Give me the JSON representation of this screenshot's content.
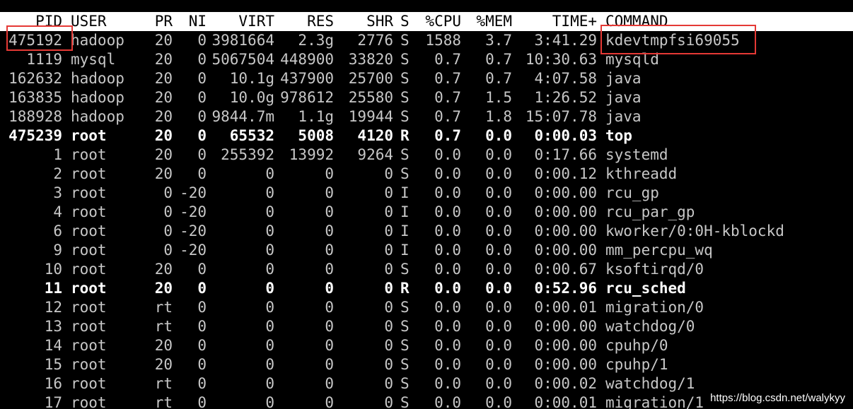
{
  "colors": {
    "background": "#000000",
    "text": "#c7c7c7",
    "text_running": "#ffffff",
    "header_bg": "#ffffff",
    "header_text": "#000000",
    "highlight": "#e53935"
  },
  "header": {
    "pid": "PID",
    "user": "USER",
    "pr": "PR",
    "ni": "NI",
    "virt": "VIRT",
    "res": "RES",
    "shr": "SHR",
    "s": "S",
    "cpu": "%CPU",
    "mem": "%MEM",
    "time": "TIME+",
    "command": "COMMAND"
  },
  "processes": [
    {
      "pid": "475192",
      "user": "hadoop",
      "pr": "20",
      "ni": "0",
      "virt": "3981664",
      "res": "2.3g",
      "shr": "2776",
      "s": "S",
      "cpu": "1588",
      "mem": "3.7",
      "time": "3:41.29",
      "command": "kdevtmpfsi69055",
      "running": false
    },
    {
      "pid": "1119",
      "user": "mysql",
      "pr": "20",
      "ni": "0",
      "virt": "5067504",
      "res": "448900",
      "shr": "33820",
      "s": "S",
      "cpu": "0.7",
      "mem": "0.7",
      "time": "10:30.63",
      "command": "mysqld",
      "running": false
    },
    {
      "pid": "162632",
      "user": "hadoop",
      "pr": "20",
      "ni": "0",
      "virt": "10.1g",
      "res": "437900",
      "shr": "25700",
      "s": "S",
      "cpu": "0.7",
      "mem": "0.7",
      "time": "4:07.58",
      "command": "java",
      "running": false
    },
    {
      "pid": "163835",
      "user": "hadoop",
      "pr": "20",
      "ni": "0",
      "virt": "10.0g",
      "res": "978612",
      "shr": "25580",
      "s": "S",
      "cpu": "0.7",
      "mem": "1.5",
      "time": "1:26.52",
      "command": "java",
      "running": false
    },
    {
      "pid": "188928",
      "user": "hadoop",
      "pr": "20",
      "ni": "0",
      "virt": "9844.7m",
      "res": "1.1g",
      "shr": "19944",
      "s": "S",
      "cpu": "0.7",
      "mem": "1.8",
      "time": "15:07.78",
      "command": "java",
      "running": false
    },
    {
      "pid": "475239",
      "user": "root",
      "pr": "20",
      "ni": "0",
      "virt": "65532",
      "res": "5008",
      "shr": "4120",
      "s": "R",
      "cpu": "0.7",
      "mem": "0.0",
      "time": "0:00.03",
      "command": "top",
      "running": true
    },
    {
      "pid": "1",
      "user": "root",
      "pr": "20",
      "ni": "0",
      "virt": "255392",
      "res": "13992",
      "shr": "9264",
      "s": "S",
      "cpu": "0.0",
      "mem": "0.0",
      "time": "0:17.66",
      "command": "systemd",
      "running": false
    },
    {
      "pid": "2",
      "user": "root",
      "pr": "20",
      "ni": "0",
      "virt": "0",
      "res": "0",
      "shr": "0",
      "s": "S",
      "cpu": "0.0",
      "mem": "0.0",
      "time": "0:00.12",
      "command": "kthreadd",
      "running": false
    },
    {
      "pid": "3",
      "user": "root",
      "pr": "0",
      "ni": "-20",
      "virt": "0",
      "res": "0",
      "shr": "0",
      "s": "I",
      "cpu": "0.0",
      "mem": "0.0",
      "time": "0:00.00",
      "command": "rcu_gp",
      "running": false
    },
    {
      "pid": "4",
      "user": "root",
      "pr": "0",
      "ni": "-20",
      "virt": "0",
      "res": "0",
      "shr": "0",
      "s": "I",
      "cpu": "0.0",
      "mem": "0.0",
      "time": "0:00.00",
      "command": "rcu_par_gp",
      "running": false
    },
    {
      "pid": "6",
      "user": "root",
      "pr": "0",
      "ni": "-20",
      "virt": "0",
      "res": "0",
      "shr": "0",
      "s": "I",
      "cpu": "0.0",
      "mem": "0.0",
      "time": "0:00.00",
      "command": "kworker/0:0H-kblockd",
      "running": false
    },
    {
      "pid": "9",
      "user": "root",
      "pr": "0",
      "ni": "-20",
      "virt": "0",
      "res": "0",
      "shr": "0",
      "s": "I",
      "cpu": "0.0",
      "mem": "0.0",
      "time": "0:00.00",
      "command": "mm_percpu_wq",
      "running": false
    },
    {
      "pid": "10",
      "user": "root",
      "pr": "20",
      "ni": "0",
      "virt": "0",
      "res": "0",
      "shr": "0",
      "s": "S",
      "cpu": "0.0",
      "mem": "0.0",
      "time": "0:00.67",
      "command": "ksoftirqd/0",
      "running": false
    },
    {
      "pid": "11",
      "user": "root",
      "pr": "20",
      "ni": "0",
      "virt": "0",
      "res": "0",
      "shr": "0",
      "s": "R",
      "cpu": "0.0",
      "mem": "0.0",
      "time": "0:52.96",
      "command": "rcu_sched",
      "running": true
    },
    {
      "pid": "12",
      "user": "root",
      "pr": "rt",
      "ni": "0",
      "virt": "0",
      "res": "0",
      "shr": "0",
      "s": "S",
      "cpu": "0.0",
      "mem": "0.0",
      "time": "0:00.01",
      "command": "migration/0",
      "running": false
    },
    {
      "pid": "13",
      "user": "root",
      "pr": "rt",
      "ni": "0",
      "virt": "0",
      "res": "0",
      "shr": "0",
      "s": "S",
      "cpu": "0.0",
      "mem": "0.0",
      "time": "0:00.00",
      "command": "watchdog/0",
      "running": false
    },
    {
      "pid": "14",
      "user": "root",
      "pr": "20",
      "ni": "0",
      "virt": "0",
      "res": "0",
      "shr": "0",
      "s": "S",
      "cpu": "0.0",
      "mem": "0.0",
      "time": "0:00.00",
      "command": "cpuhp/0",
      "running": false
    },
    {
      "pid": "15",
      "user": "root",
      "pr": "20",
      "ni": "0",
      "virt": "0",
      "res": "0",
      "shr": "0",
      "s": "S",
      "cpu": "0.0",
      "mem": "0.0",
      "time": "0:00.00",
      "command": "cpuhp/1",
      "running": false
    },
    {
      "pid": "16",
      "user": "root",
      "pr": "rt",
      "ni": "0",
      "virt": "0",
      "res": "0",
      "shr": "0",
      "s": "S",
      "cpu": "0.0",
      "mem": "0.0",
      "time": "0:00.02",
      "command": "watchdog/1",
      "running": false
    },
    {
      "pid": "17",
      "user": "root",
      "pr": "rt",
      "ni": "0",
      "virt": "0",
      "res": "0",
      "shr": "0",
      "s": "S",
      "cpu": "0.0",
      "mem": "0.0",
      "time": "0:00.01",
      "command": "migration/1",
      "running": false
    }
  ],
  "watermark": "https://blog.csdn.net/walykyy"
}
